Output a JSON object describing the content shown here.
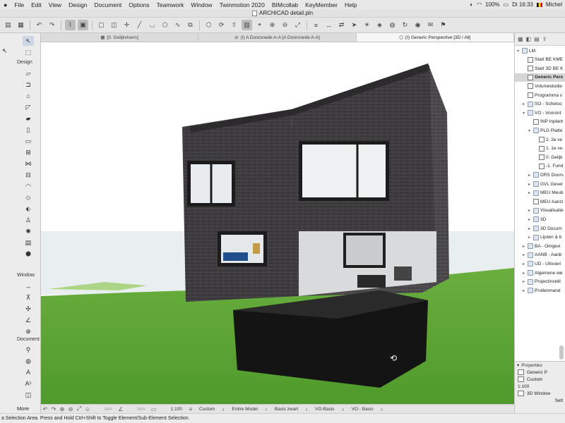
{
  "menubar": {
    "apple": "",
    "items": [
      "File",
      "Edit",
      "View",
      "Design",
      "Document",
      "Options",
      "Teamwork",
      "Window",
      "Twinmotion 2020",
      "BIMcollab",
      "KeyMember",
      "Help"
    ],
    "battery": "100%",
    "clock": "Di 16:33",
    "user": "Michel"
  },
  "window": {
    "title": "ARCHICAD detail.pln"
  },
  "tabs": [
    {
      "label": "[0. Gelijkvloers]"
    },
    {
      "label": "(I) A Doorsnede A-A [A Doorsnede A-A]"
    },
    {
      "label": "(I) Generic Perspective [3D / All]"
    }
  ],
  "toolbox": {
    "sections": {
      "design": "Design",
      "window": "Window",
      "document": "Document"
    },
    "more": "More"
  },
  "navigator": {
    "items": [
      {
        "label": "LM",
        "level": 0,
        "tri": "▾",
        "type": "folder"
      },
      {
        "label": "Start BE KME",
        "level": 1,
        "tri": "",
        "type": "page"
      },
      {
        "label": "Start 3D BE K",
        "level": 1,
        "tri": "",
        "type": "page"
      },
      {
        "label": "Generic Pers",
        "level": 1,
        "tri": "",
        "type": "page",
        "selected": true
      },
      {
        "label": "Volumestudie",
        "level": 1,
        "tri": "",
        "type": "page"
      },
      {
        "label": "Programma v",
        "level": 1,
        "tri": "",
        "type": "page"
      },
      {
        "label": "SO - Schetso",
        "level": 1,
        "tri": "▸",
        "type": "folder"
      },
      {
        "label": "VO - Vooront",
        "level": 1,
        "tri": "▾",
        "type": "folder"
      },
      {
        "label": "INP Inplant",
        "level": 2,
        "tri": "",
        "type": "page"
      },
      {
        "label": "PLG Platte",
        "level": 2,
        "tri": "▾",
        "type": "folder"
      },
      {
        "label": "2. 2e ve",
        "level": 3,
        "tri": "",
        "type": "page"
      },
      {
        "label": "1. 1e ve",
        "level": 3,
        "tri": "",
        "type": "page"
      },
      {
        "label": "0. Gelijk",
        "level": 3,
        "tri": "",
        "type": "page"
      },
      {
        "label": "-1. Fund",
        "level": 3,
        "tri": "",
        "type": "page"
      },
      {
        "label": "DRS Doors",
        "level": 2,
        "tri": "▸",
        "type": "folder"
      },
      {
        "label": "GVL Gevel",
        "level": 2,
        "tri": "▸",
        "type": "folder"
      },
      {
        "label": "MEU Meub",
        "level": 2,
        "tri": "▸",
        "type": "folder"
      },
      {
        "label": "MEU Aanzi",
        "level": 2,
        "tri": "",
        "type": "page"
      },
      {
        "label": "Visualisatie",
        "level": 2,
        "tri": "▸",
        "type": "folder"
      },
      {
        "label": "3D",
        "level": 2,
        "tri": "▸",
        "type": "folder"
      },
      {
        "label": "3D Docum",
        "level": 2,
        "tri": "▸",
        "type": "folder"
      },
      {
        "label": "Lijsten & b",
        "level": 2,
        "tri": "▸",
        "type": "folder"
      },
      {
        "label": "BA - Omgevi",
        "level": 1,
        "tri": "▸",
        "type": "folder"
      },
      {
        "label": "AANB - Aanb",
        "level": 1,
        "tri": "▸",
        "type": "folder"
      },
      {
        "label": "UD - Uitvoeri",
        "level": 1,
        "tri": "▸",
        "type": "folder"
      },
      {
        "label": "Algemene we",
        "level": 1,
        "tri": "▸",
        "type": "folder"
      },
      {
        "label": "Projectinstell",
        "level": 1,
        "tri": "▸",
        "type": "folder"
      },
      {
        "label": "Prullenmand",
        "level": 1,
        "tri": "▸",
        "type": "folder"
      }
    ]
  },
  "properties": {
    "header": "Properties",
    "name": "Generic P",
    "layer_combo": "Custom",
    "scale": "1:100",
    "view": "3D Window",
    "settings": "Sett"
  },
  "statusbar": {
    "na1": "N/A",
    "na2": "N/A",
    "scale": "1:100",
    "layer_combo": "Custom",
    "model_view": "Entire Model",
    "pen_set": "Basis zwart",
    "mvo": "VO-Basis",
    "view_set": "VO - Basis"
  },
  "hint": "a Selection Area. Press and Hold Ctrl+Shift to Toggle Element/Sub-Element Selection.",
  "colors": {
    "sky": "#ffffff",
    "ground": "#5aa032",
    "brick": "#3c3a3c",
    "selection": "#d6d6d6"
  }
}
